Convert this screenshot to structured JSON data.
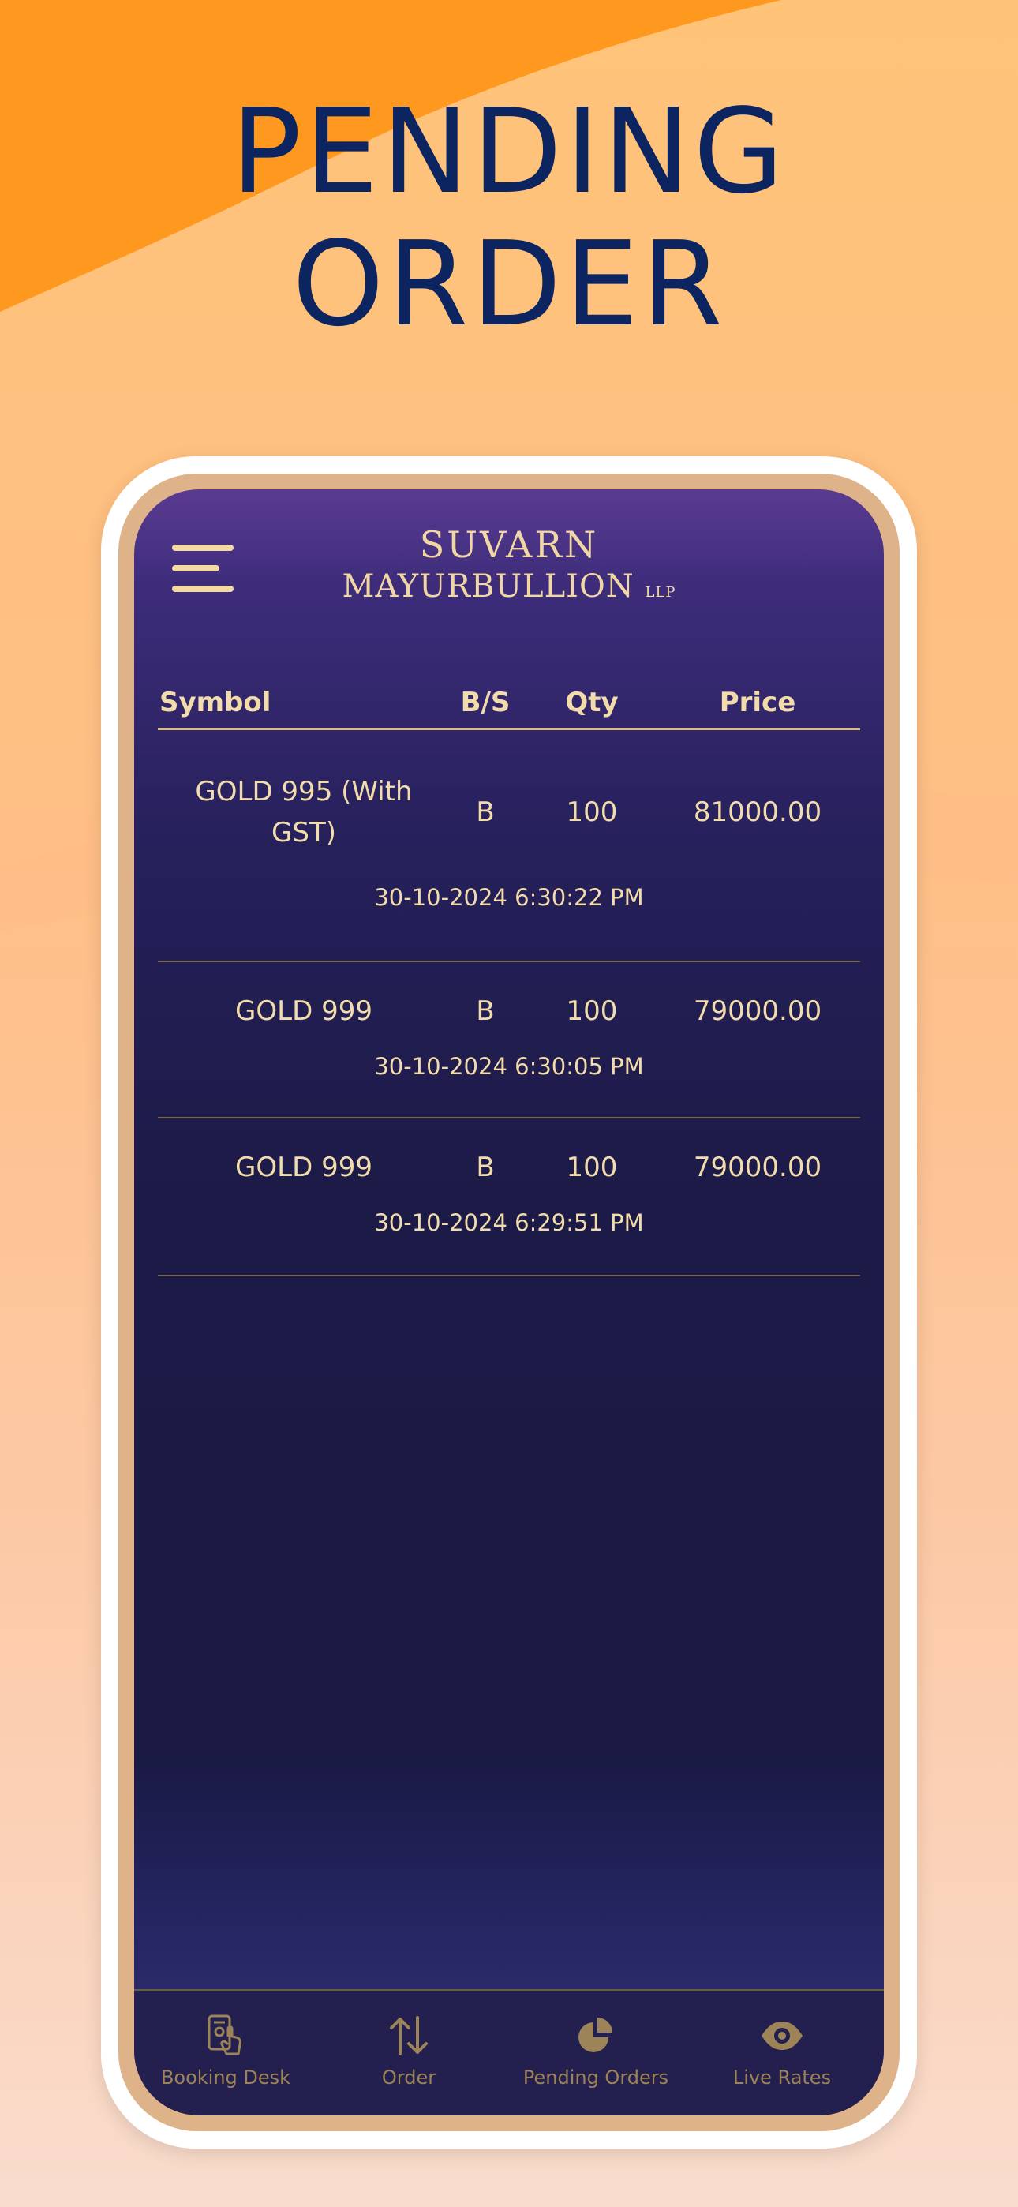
{
  "headline": {
    "line1": "PENDING",
    "line2": "ORDER"
  },
  "app": {
    "logo_line1": "SUVARN",
    "logo_line2": "MAYURBULLION",
    "logo_suffix": "LLP"
  },
  "table": {
    "headers": {
      "symbol": "Symbol",
      "bs": "B/S",
      "qty": "Qty",
      "price": "Price"
    },
    "rows": [
      {
        "symbol_line1": "GOLD 995 (With",
        "symbol_line2": "GST)",
        "bs": "B",
        "qty": "100",
        "price": "81000.00",
        "time": "30-10-2024 6:30:22 PM"
      },
      {
        "symbol_line1": "GOLD 999",
        "bs": "B",
        "qty": "100",
        "price": "79000.00",
        "time": "30-10-2024 6:30:05 PM"
      },
      {
        "symbol_line1": "GOLD 999",
        "bs": "B",
        "qty": "100",
        "price": "79000.00",
        "time": "30-10-2024 6:29:51 PM"
      }
    ]
  },
  "nav": {
    "items": [
      {
        "label": "Booking Desk",
        "icon": "booking-desk-icon"
      },
      {
        "label": "Order",
        "icon": "swap-arrows-icon"
      },
      {
        "label": "Pending Orders",
        "icon": "pie-chart-icon"
      },
      {
        "label": "Live Rates",
        "icon": "eye-icon"
      }
    ]
  },
  "colors": {
    "gold_text": "#f1d7a4",
    "headline": "#0c2560",
    "bg_orange": "#ff981f",
    "screen_top": "#5a3b92",
    "screen_mid": "#1c1a46",
    "nav_icon": "#9c8358"
  }
}
